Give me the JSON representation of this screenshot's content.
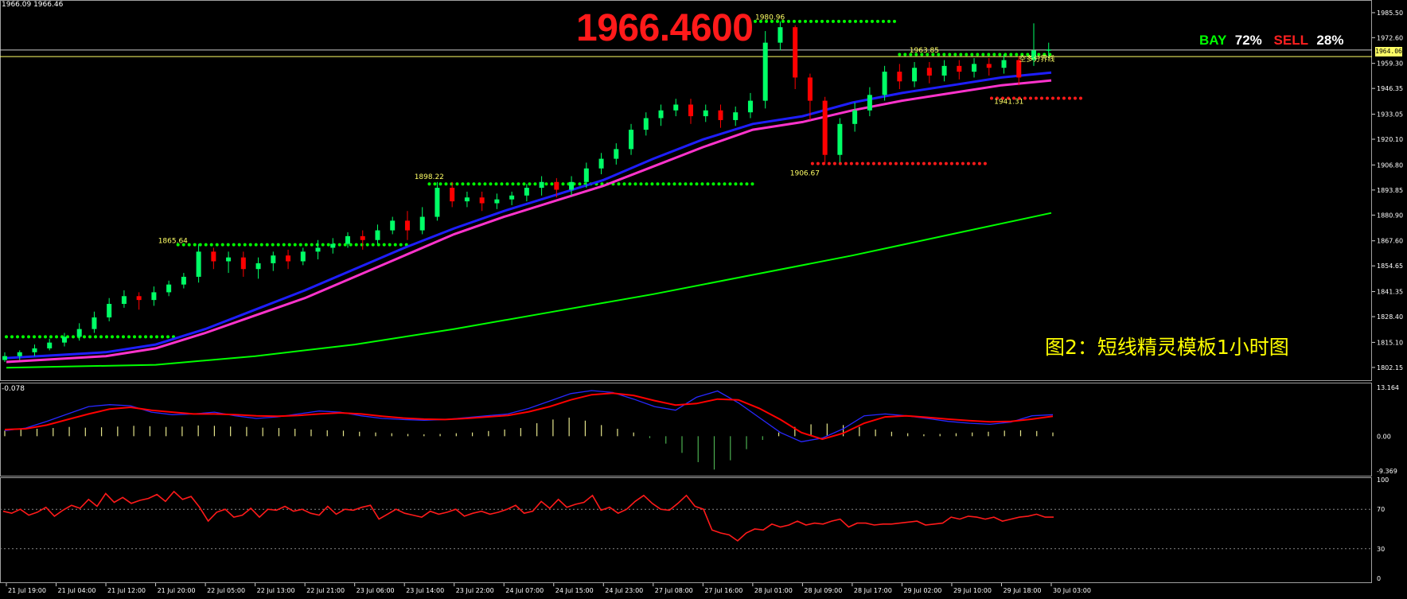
{
  "header": {
    "ohlc": "1966.09 1966.46"
  },
  "big_price": "1966.4600",
  "caption": "图2：短线精灵模板1小时图",
  "sentiment": {
    "buy_label": "BAY",
    "buy_pct": "72%",
    "sell_label": "SELL",
    "sell_pct": "28%"
  },
  "current_price": "1964.06",
  "sub_header": "-0.078",
  "colors": {
    "background": "#000000",
    "bull": "#00ff66",
    "bear": "#ff0000",
    "support_dots": "#00ff00",
    "resistance_dots": "#ff1a1a",
    "ma_blue": "#1e1eff",
    "ma_magenta": "#ff33cc",
    "ma_long": "#00ff00",
    "macd_line": "#ff0000",
    "signal_line": "#2828ff",
    "rsi_line": "#ff1a1a"
  },
  "chart_data": [
    {
      "type": "line",
      "title": "",
      "ylim": [
        1798,
        1990
      ],
      "y_ticks": [
        "1985.50",
        "1972.60",
        "1959.30",
        "1946.35",
        "1933.05",
        "1920.10",
        "1906.80",
        "1893.85",
        "1880.90",
        "1867.60",
        "1854.65",
        "1841.35",
        "1828.40",
        "1815.10",
        "1802.15"
      ],
      "x_ticks": [
        "21 Jul 19:00",
        "21 Jul 04:00",
        "21 Jul 12:00",
        "21 Jul 20:00",
        "22 Jul 05:00",
        "22 Jul 13:00",
        "22 Jul 21:00",
        "23 Jul 06:00",
        "23 Jul 14:00",
        "23 Jul 22:00",
        "24 Jul 07:00",
        "24 Jul 15:00",
        "24 Jul 23:00",
        "27 Jul 08:00",
        "27 Jul 16:00",
        "28 Jul 01:00",
        "28 Jul 09:00",
        "28 Jul 17:00",
        "29 Jul 02:00",
        "29 Jul 10:00",
        "29 Jul 18:00",
        "30 Jul 03:00"
      ],
      "annotations": [
        {
          "text": "1865.64",
          "x_index": 3.05,
          "y": 1866.5
        },
        {
          "text": "1898.22",
          "x_index": 8.2,
          "y": 1899.5
        },
        {
          "text": "1980.96",
          "x_index": 15.05,
          "y": 1982.0
        },
        {
          "text": "1963.85",
          "x_index": 18.15,
          "y": 1965.0
        },
        {
          "text": "1941.31",
          "x_index": 19.85,
          "y": 1938.5
        },
        {
          "text": "1906.67",
          "x_index": 15.75,
          "y": 1901.5
        },
        {
          "text": "空多分界线",
          "x_index": 20.35,
          "y": 1960.5
        }
      ],
      "level_lines": [
        {
          "kind": "support",
          "y": 1818.0,
          "x_from": 0.0,
          "x_to": 3.4
        },
        {
          "kind": "support",
          "y": 1865.6,
          "x_from": 3.45,
          "x_to": 8.15
        },
        {
          "kind": "support",
          "y": 1897.0,
          "x_from": 8.5,
          "x_to": 15.0
        },
        {
          "kind": "support",
          "y": 1981.0,
          "x_from": 15.05,
          "x_to": 17.95
        },
        {
          "kind": "support",
          "y": 1963.9,
          "x_from": 17.95,
          "x_to": 21.0
        },
        {
          "kind": "resistance",
          "y": 1941.3,
          "x_from": 19.8,
          "x_to": 21.7
        },
        {
          "kind": "resistance",
          "y": 1907.5,
          "x_from": 16.2,
          "x_to": 19.7
        }
      ],
      "horizontal_lines": [
        {
          "y": 1966.2,
          "color": "#cccccc"
        },
        {
          "y": 1962.8,
          "color": "#ffff66"
        }
      ],
      "series": [
        {
          "kind": "ma",
          "color": "#1e1eff",
          "points": [
            [
              0,
              1807
            ],
            [
              2,
              1810
            ],
            [
              3,
              1814
            ],
            [
              4,
              1822
            ],
            [
              5,
              1832
            ],
            [
              6,
              1842
            ],
            [
              7,
              1853
            ],
            [
              8,
              1864
            ],
            [
              9,
              1874
            ],
            [
              10,
              1883
            ],
            [
              11,
              1891
            ],
            [
              12,
              1899
            ],
            [
              13,
              1910
            ],
            [
              14,
              1920
            ],
            [
              15,
              1928
            ],
            [
              16,
              1932
            ],
            [
              17,
              1939
            ],
            [
              18,
              1944
            ],
            [
              19,
              1948
            ],
            [
              20,
              1952
            ],
            [
              21,
              1954.5
            ]
          ]
        },
        {
          "kind": "ma",
          "color": "#ff33cc",
          "points": [
            [
              0,
              1805
            ],
            [
              2,
              1808
            ],
            [
              3,
              1812
            ],
            [
              4,
              1820
            ],
            [
              5,
              1829
            ],
            [
              6,
              1838
            ],
            [
              7,
              1849
            ],
            [
              8,
              1860
            ],
            [
              9,
              1871
            ],
            [
              10,
              1880
            ],
            [
              11,
              1888
            ],
            [
              12,
              1896
            ],
            [
              13,
              1906
            ],
            [
              14,
              1916
            ],
            [
              15,
              1925
            ],
            [
              16,
              1929
            ],
            [
              17,
              1935
            ],
            [
              18,
              1940
            ],
            [
              19,
              1944
            ],
            [
              20,
              1948
            ],
            [
              21,
              1950.5
            ]
          ]
        },
        {
          "kind": "ma",
          "color": "#00ff00",
          "points": [
            [
              0,
              1802
            ],
            [
              3,
              1803.5
            ],
            [
              5,
              1808
            ],
            [
              7,
              1814
            ],
            [
              9,
              1822
            ],
            [
              11,
              1831
            ],
            [
              13,
              1840
            ],
            [
              15,
              1850
            ],
            [
              17,
              1860
            ],
            [
              19,
              1871
            ],
            [
              21,
              1882
            ]
          ]
        }
      ],
      "candles": [
        [
          1806,
          1808,
          1805,
          1810
        ],
        [
          1808,
          1810,
          1806,
          1811
        ],
        [
          1810,
          1812,
          1808,
          1814
        ],
        [
          1812,
          1815,
          1811,
          1817
        ],
        [
          1815,
          1818,
          1813,
          1820
        ],
        [
          1818,
          1822,
          1816,
          1825
        ],
        [
          1822,
          1828,
          1820,
          1831
        ],
        [
          1828,
          1835,
          1826,
          1838
        ],
        [
          1835,
          1839,
          1833,
          1842
        ],
        [
          1839,
          1837,
          1832,
          1841
        ],
        [
          1837,
          1841,
          1834,
          1844
        ],
        [
          1841,
          1845,
          1839,
          1847
        ],
        [
          1845,
          1849,
          1843,
          1851
        ],
        [
          1849,
          1862,
          1846,
          1866
        ],
        [
          1862,
          1857,
          1853,
          1864
        ],
        [
          1857,
          1859,
          1851,
          1862
        ],
        [
          1859,
          1853,
          1849,
          1862
        ],
        [
          1853,
          1856,
          1848,
          1859
        ],
        [
          1856,
          1860,
          1852,
          1862
        ],
        [
          1860,
          1857,
          1853,
          1863
        ],
        [
          1857,
          1862,
          1855,
          1864
        ],
        [
          1862,
          1864,
          1858,
          1868
        ],
        [
          1864,
          1866,
          1861,
          1869
        ],
        [
          1866,
          1870,
          1864,
          1872
        ],
        [
          1870,
          1868,
          1863,
          1873
        ],
        [
          1868,
          1873,
          1866,
          1876
        ],
        [
          1873,
          1878,
          1871,
          1880
        ],
        [
          1878,
          1873,
          1868,
          1883
        ],
        [
          1873,
          1880,
          1871,
          1885
        ],
        [
          1880,
          1895,
          1878,
          1898
        ],
        [
          1895,
          1888,
          1885,
          1898
        ],
        [
          1888,
          1890,
          1885,
          1893
        ],
        [
          1890,
          1887,
          1883,
          1893
        ],
        [
          1887,
          1889,
          1884,
          1892
        ],
        [
          1889,
          1891,
          1886,
          1893
        ],
        [
          1891,
          1895,
          1888,
          1897
        ],
        [
          1895,
          1898,
          1891,
          1901
        ],
        [
          1898,
          1894,
          1890,
          1900
        ],
        [
          1894,
          1898,
          1891,
          1901
        ],
        [
          1898,
          1905,
          1895,
          1908
        ],
        [
          1905,
          1910,
          1902,
          1913
        ],
        [
          1910,
          1915,
          1907,
          1918
        ],
        [
          1915,
          1925,
          1912,
          1928
        ],
        [
          1925,
          1931,
          1922,
          1934
        ],
        [
          1931,
          1935,
          1927,
          1938
        ],
        [
          1935,
          1938,
          1932,
          1941
        ],
        [
          1938,
          1932,
          1928,
          1941
        ],
        [
          1932,
          1935,
          1929,
          1938
        ],
        [
          1935,
          1930,
          1926,
          1938
        ],
        [
          1930,
          1934,
          1927,
          1937
        ],
        [
          1934,
          1940,
          1931,
          1944
        ],
        [
          1940,
          1970,
          1936,
          1976
        ],
        [
          1970,
          1978,
          1966,
          1981
        ],
        [
          1978,
          1952,
          1946,
          1979
        ],
        [
          1952,
          1940,
          1930,
          1954
        ],
        [
          1940,
          1912,
          1907,
          1942
        ],
        [
          1912,
          1928,
          1908,
          1931
        ],
        [
          1928,
          1935,
          1924,
          1939
        ],
        [
          1935,
          1943,
          1932,
          1947
        ],
        [
          1943,
          1955,
          1940,
          1958
        ],
        [
          1955,
          1950,
          1946,
          1959
        ],
        [
          1950,
          1957,
          1947,
          1960
        ],
        [
          1957,
          1953,
          1949,
          1960
        ],
        [
          1953,
          1958,
          1950,
          1961
        ],
        [
          1958,
          1955,
          1951,
          1961
        ],
        [
          1955,
          1959,
          1952,
          1962
        ],
        [
          1959,
          1957,
          1953,
          1962
        ],
        [
          1957,
          1961,
          1954,
          1964
        ],
        [
          1961,
          1952,
          1948,
          1963
        ],
        [
          1961,
          1966,
          1958,
          1980
        ],
        [
          1966,
          1966.46,
          1962,
          1970
        ]
      ]
    },
    {
      "type": "line",
      "title": "",
      "ylim": [
        -9.369,
        13.164
      ],
      "y_ticks": [
        "13.164",
        "0.00",
        "-9.369"
      ],
      "histogram": [
        1.5,
        1.8,
        2.0,
        2.2,
        2.5,
        2.3,
        2.4,
        2.6,
        2.8,
        2.7,
        2.5,
        2.6,
        2.9,
        2.8,
        2.6,
        2.5,
        2.3,
        2.2,
        2.0,
        1.8,
        1.6,
        1.5,
        1.2,
        1.0,
        0.8,
        0.6,
        0.5,
        0.6,
        0.8,
        1.0,
        1.4,
        1.8,
        2.2,
        3.5,
        4.5,
        5.0,
        4.2,
        3.0,
        2.0,
        1.0,
        -0.5,
        -2.0,
        -4.5,
        -7.0,
        -9.0,
        -6.5,
        -3.5,
        -1.0,
        1.0,
        2.5,
        3.2,
        3.4,
        3.0,
        2.5,
        1.8,
        1.2,
        0.8,
        0.5,
        0.6,
        0.8,
        1.0,
        1.2,
        1.5,
        1.6,
        1.4,
        1.0
      ],
      "series": [
        {
          "name": "",
          "color": "#2828ff",
          "values": [
            1.5,
            2.2,
            4.0,
            6.0,
            8.0,
            8.5,
            8.2,
            6.5,
            5.8,
            6.0,
            6.5,
            5.5,
            4.8,
            5.2,
            6.0,
            6.8,
            6.5,
            5.5,
            4.8,
            4.5,
            4.3,
            4.5,
            5.0,
            5.5,
            6.0,
            7.5,
            9.5,
            11.5,
            12.3,
            11.8,
            10.0,
            8.0,
            7.0,
            10.5,
            12.2,
            9.0,
            5.0,
            1.0,
            -1.5,
            -0.5,
            2.0,
            5.5,
            6.0,
            5.5,
            4.8,
            4.0,
            3.5,
            3.2,
            3.8,
            5.5,
            5.8
          ]
        },
        {
          "name": "",
          "color": "#ff0000",
          "values": [
            1.8,
            2.0,
            3.0,
            4.5,
            6.0,
            7.3,
            7.8,
            7.0,
            6.5,
            6.0,
            6.0,
            5.8,
            5.5,
            5.4,
            5.6,
            6.0,
            6.3,
            6.0,
            5.4,
            4.9,
            4.6,
            4.5,
            4.8,
            5.2,
            5.6,
            6.6,
            8.0,
            9.8,
            11.2,
            11.6,
            11.0,
            9.6,
            8.4,
            8.8,
            10.0,
            9.8,
            7.5,
            4.5,
            1.0,
            -0.8,
            0.8,
            3.5,
            5.2,
            5.5,
            5.1,
            4.6,
            4.2,
            3.9,
            4.0,
            4.6,
            5.4
          ]
        }
      ]
    },
    {
      "type": "line",
      "title": "",
      "ylim": [
        0,
        100
      ],
      "y_ticks": [
        "100",
        "70",
        "30",
        "0"
      ],
      "reference_lines": [
        70,
        30
      ],
      "series": [
        {
          "name": "",
          "color": "#ff1a1a",
          "values": [
            68,
            66,
            70,
            64,
            67,
            72,
            63,
            69,
            74,
            71,
            80,
            73,
            86,
            77,
            82,
            76,
            79,
            81,
            85,
            78,
            88,
            80,
            83,
            72,
            58,
            67,
            70,
            62,
            64,
            71,
            62,
            70,
            69,
            73,
            68,
            70,
            66,
            64,
            73,
            65,
            70,
            69,
            72,
            74,
            60,
            65,
            70,
            66,
            64,
            62,
            68,
            65,
            67,
            70,
            63,
            66,
            68,
            65,
            67,
            70,
            74,
            66,
            68,
            78,
            71,
            80,
            72,
            75,
            77,
            84,
            69,
            72,
            66,
            70,
            78,
            84,
            76,
            70,
            69,
            76,
            84,
            73,
            70,
            49,
            46,
            44,
            38,
            46,
            50,
            49,
            55,
            52,
            54,
            58,
            54,
            56,
            55,
            58,
            60,
            52,
            56,
            56,
            54,
            55,
            55,
            56,
            57,
            58,
            54,
            55,
            56,
            62,
            60,
            63,
            62,
            60,
            62,
            58,
            60,
            62,
            63,
            65,
            62,
            62
          ]
        }
      ]
    }
  ]
}
